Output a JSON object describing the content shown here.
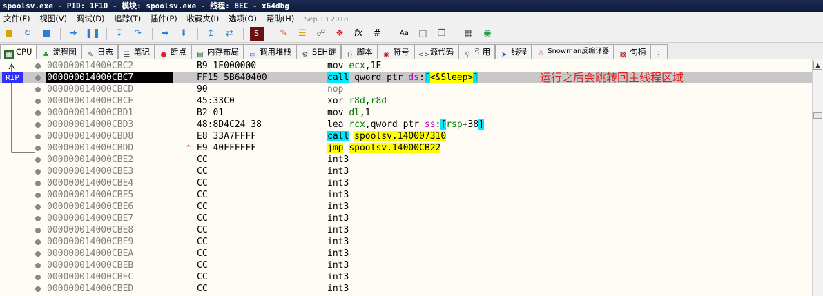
{
  "window": {
    "title": "spoolsv.exe - PID: 1F10 - 模块: spoolsv.exe - 线程: 8EC - x64dbg"
  },
  "menu": {
    "items": [
      "文件(F)",
      "视图(V)",
      "调试(D)",
      "追踪(T)",
      "插件(P)",
      "收藏夹(I)",
      "选项(O)",
      "帮助(H)"
    ],
    "date": "Sep 13 2018"
  },
  "toolbar": {
    "icons": [
      "open-icon",
      "restart-icon",
      "stop-icon",
      "run-icon",
      "pause-icon",
      "step-into-icon",
      "step-over-icon",
      "trace-into-icon",
      "trace-over-icon",
      "run-to-user-icon",
      "run-to-ret-icon",
      "script-icon",
      "patch-icon",
      "comments-icon",
      "labels-icon",
      "bookmarks-icon",
      "functions-icon",
      "hash-icon",
      "font-icon",
      "strings-icon",
      "calculator-icon",
      "globe-icon"
    ],
    "fx_label": "fx",
    "hash_label": "#",
    "font_label": "Aa"
  },
  "tabs": [
    {
      "label": "CPU",
      "icon": "cpu-icon"
    },
    {
      "label": "流程图",
      "icon": "graph-icon"
    },
    {
      "label": "日志",
      "icon": "log-icon"
    },
    {
      "label": "笔记",
      "icon": "notes-icon"
    },
    {
      "label": "断点",
      "icon": "breakpoint-icon"
    },
    {
      "label": "内存布局",
      "icon": "memory-map-icon"
    },
    {
      "label": "调用堆栈",
      "icon": "call-stack-icon"
    },
    {
      "label": "SEH链",
      "icon": "seh-icon"
    },
    {
      "label": "脚本",
      "icon": "script-tab-icon"
    },
    {
      "label": "符号",
      "icon": "symbols-icon"
    },
    {
      "label": "源代码",
      "icon": "source-icon"
    },
    {
      "label": "引用",
      "icon": "references-icon"
    },
    {
      "label": "线程",
      "icon": "threads-icon"
    },
    {
      "label": "Snowman反编译器",
      "icon": "snowman-icon"
    },
    {
      "label": "句柄",
      "icon": "handles-icon"
    }
  ],
  "disasm": {
    "rip_label": "RIP",
    "annotation": "运行之后会跳转回主线程区域",
    "rows": [
      {
        "addr": "000000014000CBC2",
        "bytes": "B9 1E000000",
        "instr": "mov ecx,1E"
      },
      {
        "addr": "000000014000CBC7",
        "bytes": "FF15 5B640400",
        "instr": "call qword ptr ds:[<&Sleep>]"
      },
      {
        "addr": "000000014000CBCD",
        "bytes": "90",
        "instr": "nop"
      },
      {
        "addr": "000000014000CBCE",
        "bytes": "45:33C0",
        "instr": "xor r8d,r8d"
      },
      {
        "addr": "000000014000CBD1",
        "bytes": "B2 01",
        "instr": "mov dl,1"
      },
      {
        "addr": "000000014000CBD3",
        "bytes": "48:8D4C24 38",
        "instr": "lea rcx,qword ptr ss:[rsp+38]"
      },
      {
        "addr": "000000014000CBD8",
        "bytes": "E8 33A7FFFF",
        "instr": "call spoolsv.140007310"
      },
      {
        "addr": "000000014000CBDD",
        "bytes": "E9 40FFFFFF",
        "instr": "jmp spoolsv.14000CB22"
      },
      {
        "addr": "000000014000CBE2",
        "bytes": "CC",
        "instr": "int3"
      },
      {
        "addr": "000000014000CBE3",
        "bytes": "CC",
        "instr": "int3"
      },
      {
        "addr": "000000014000CBE4",
        "bytes": "CC",
        "instr": "int3"
      },
      {
        "addr": "000000014000CBE5",
        "bytes": "CC",
        "instr": "int3"
      },
      {
        "addr": "000000014000CBE6",
        "bytes": "CC",
        "instr": "int3"
      },
      {
        "addr": "000000014000CBE7",
        "bytes": "CC",
        "instr": "int3"
      },
      {
        "addr": "000000014000CBE8",
        "bytes": "CC",
        "instr": "int3"
      },
      {
        "addr": "000000014000CBE9",
        "bytes": "CC",
        "instr": "int3"
      },
      {
        "addr": "000000014000CBEA",
        "bytes": "CC",
        "instr": "int3"
      },
      {
        "addr": "000000014000CBEB",
        "bytes": "CC",
        "instr": "int3"
      },
      {
        "addr": "000000014000CBEC",
        "bytes": "CC",
        "instr": "int3"
      },
      {
        "addr": "000000014000CBED",
        "bytes": "CC",
        "instr": "int3"
      }
    ]
  }
}
